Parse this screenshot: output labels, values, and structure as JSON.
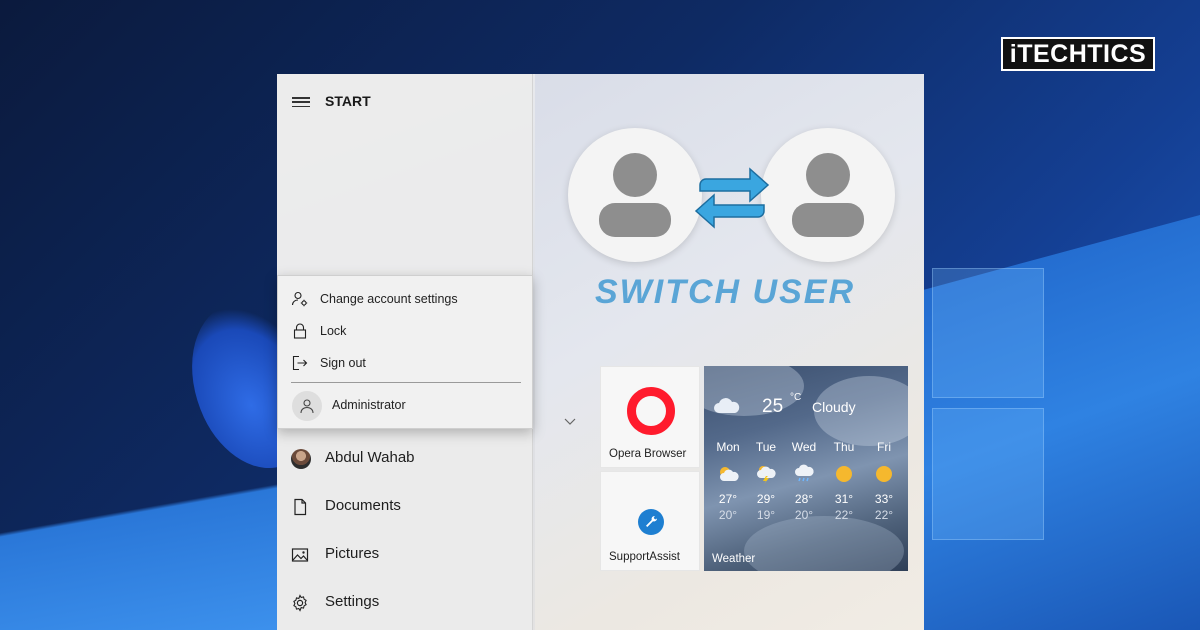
{
  "brand": {
    "text": "iTECHTICS"
  },
  "start_menu": {
    "title": "START",
    "account_popup": {
      "items": [
        {
          "label": "Change account settings",
          "icon": "account-settings-icon"
        },
        {
          "label": "Lock",
          "icon": "lock-icon"
        },
        {
          "label": "Sign out",
          "icon": "sign-out-icon"
        }
      ],
      "switch_user": {
        "label": "Administrator",
        "icon": "user-avatar-icon"
      }
    },
    "list": [
      {
        "label": "Abdul Wahab",
        "icon": "user-photo"
      },
      {
        "label": "Documents",
        "icon": "document-icon"
      },
      {
        "label": "Pictures",
        "icon": "pictures-icon"
      },
      {
        "label": "Settings",
        "icon": "gear-icon"
      }
    ]
  },
  "hero": {
    "text": "SWITCH USER",
    "color": "#5aa5d6"
  },
  "tiles": {
    "opera": {
      "label": "Opera Browser",
      "color": "#ff1b2d"
    },
    "support": {
      "label": "SupportAssist",
      "color": "#1e7fd1"
    },
    "weather": {
      "label": "Weather",
      "current_temp": "25",
      "unit": "°C",
      "condition": "Cloudy",
      "days": [
        {
          "day": "Mon",
          "icon": "partly-sunny-icon",
          "hi": "27°",
          "lo": "20°"
        },
        {
          "day": "Tue",
          "icon": "thunder-icon",
          "hi": "29°",
          "lo": "19°"
        },
        {
          "day": "Wed",
          "icon": "rain-icon",
          "hi": "28°",
          "lo": "20°"
        },
        {
          "day": "Thu",
          "icon": "sunny-icon",
          "hi": "31°",
          "lo": "22°"
        },
        {
          "day": "Fri",
          "icon": "sunny-icon",
          "hi": "33°",
          "lo": "22°"
        }
      ]
    }
  }
}
